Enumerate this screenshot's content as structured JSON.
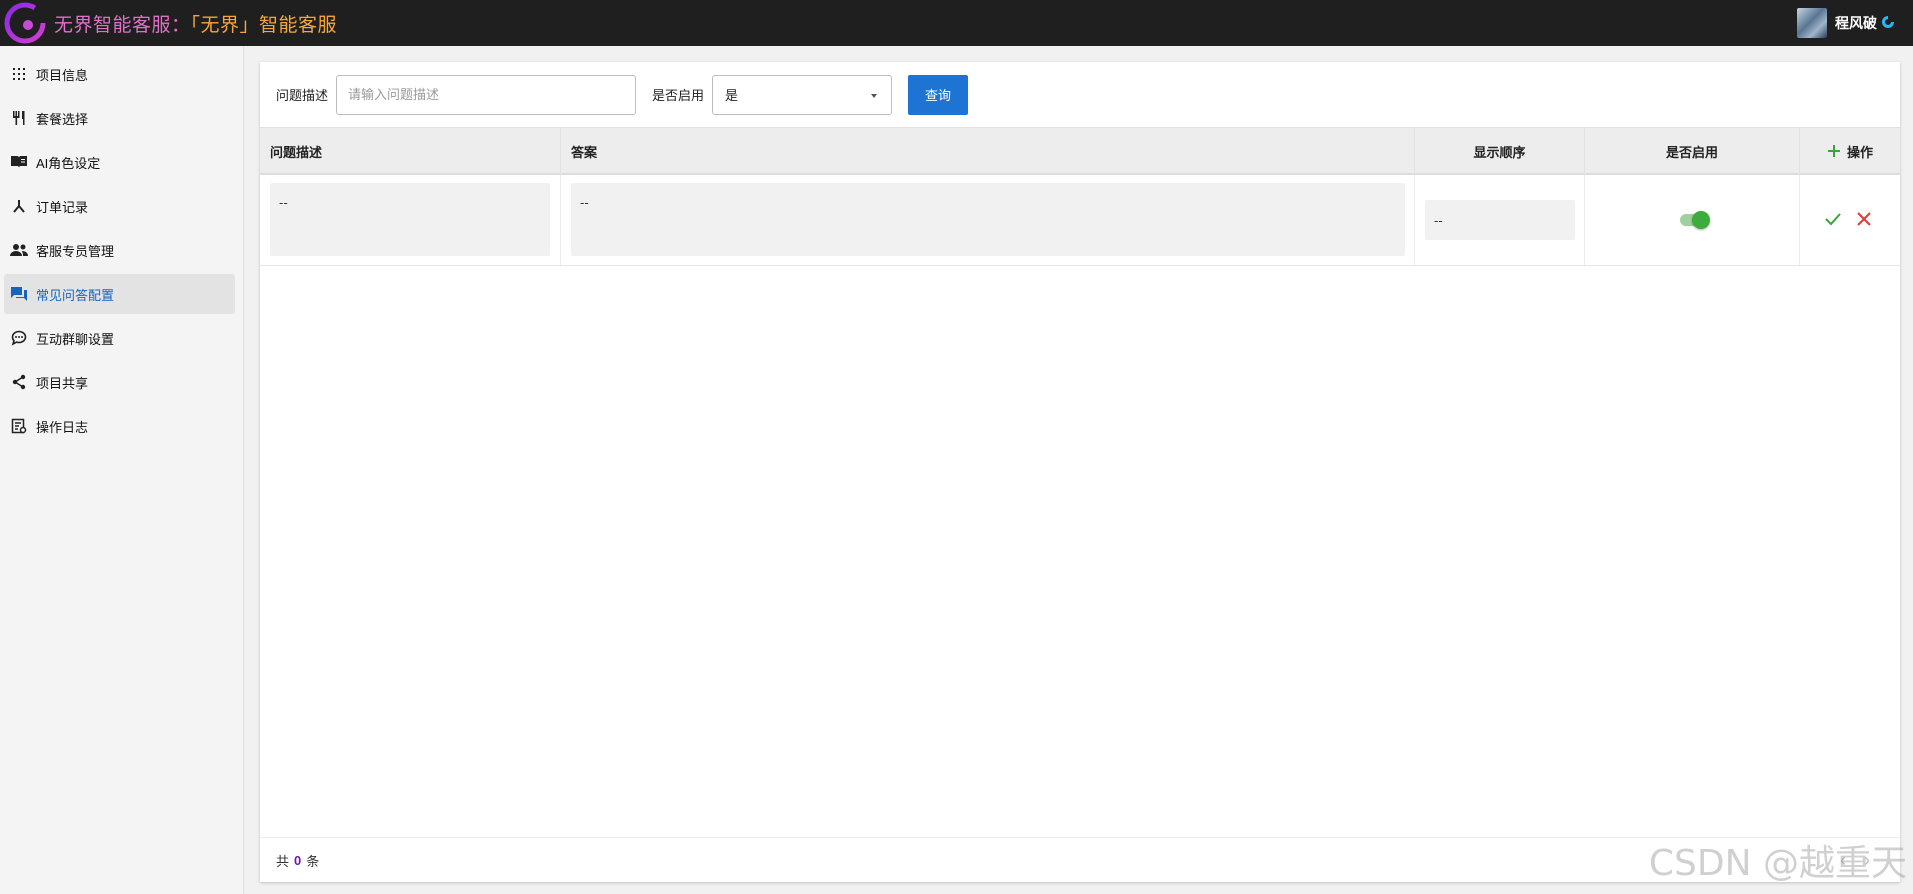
{
  "header": {
    "title_part1": "无界智能客服：",
    "title_part2": "「无界」智能客服",
    "user_name": "程风破"
  },
  "sidebar": {
    "items": [
      {
        "label": "项目信息",
        "icon": "grid-dots-icon"
      },
      {
        "label": "套餐选择",
        "icon": "utensils-icon"
      },
      {
        "label": "AI角色设定",
        "icon": "book-icon"
      },
      {
        "label": "订单记录",
        "icon": "merge-icon"
      },
      {
        "label": "客服专员管理",
        "icon": "people-icon"
      },
      {
        "label": "常见问答配置",
        "icon": "chat-icon",
        "active": true
      },
      {
        "label": "互动群聊设置",
        "icon": "comment-dots-icon"
      },
      {
        "label": "项目共享",
        "icon": "share-icon"
      },
      {
        "label": "操作日志",
        "icon": "log-icon"
      }
    ]
  },
  "filters": {
    "question_label": "问题描述",
    "question_placeholder": "请输入问题描述",
    "question_value": "",
    "enabled_label": "是否启用",
    "enabled_value": "是",
    "query_button": "查询"
  },
  "table": {
    "columns": {
      "question": "问题描述",
      "answer": "答案",
      "order": "显示顺序",
      "enabled": "是否启用",
      "actions": "操作"
    },
    "rows": [
      {
        "question": "--",
        "answer": "--",
        "order": "--",
        "enabled": true
      }
    ]
  },
  "footer": {
    "prefix": "共",
    "total": "0",
    "suffix": "条"
  },
  "colors": {
    "accent": "#1e74d2",
    "active_nav_text": "#1565c0",
    "toggle_on": "#3cac3c",
    "confirm_icon": "#3aa53a",
    "cancel_icon": "#e53935",
    "title": "#f7a63a"
  },
  "watermark": "CSDN @越重天"
}
